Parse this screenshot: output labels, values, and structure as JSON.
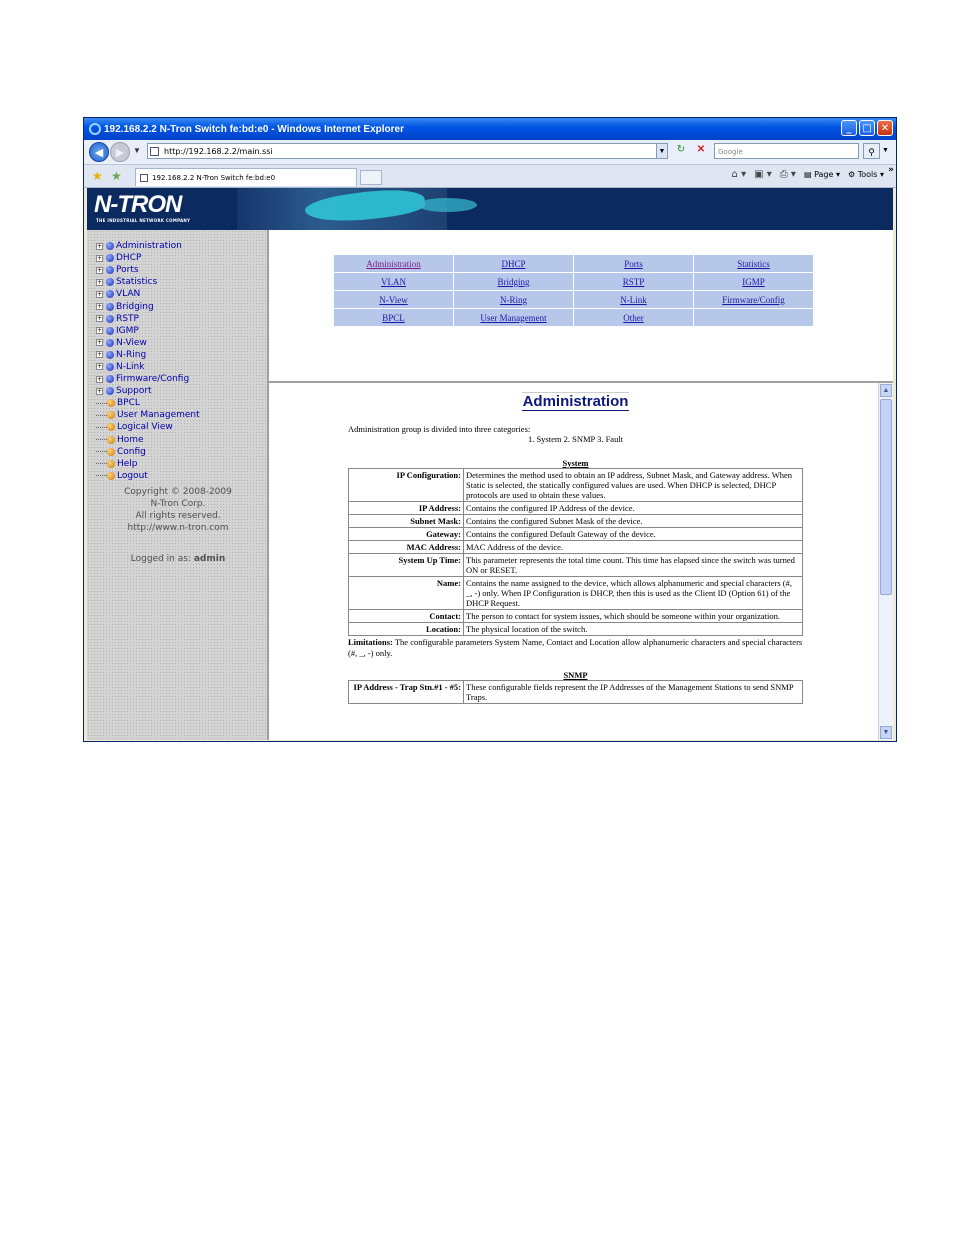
{
  "window": {
    "title": "192.168.2.2 N-Tron Switch fe:bd:e0 - Windows Internet Explorer",
    "address": "http://192.168.2.2/main.ssi",
    "search_placeholder": "Google",
    "tab_title": "192.168.2.2 N-Tron Switch fe:bd:e0",
    "cmd_page": "Page",
    "cmd_tools": "Tools"
  },
  "brand": {
    "logo": "N-TRON",
    "tagline": "THE INDUSTRIAL NETWORK COMPANY"
  },
  "sidebar": {
    "items": [
      {
        "label": "Administration",
        "expandable": true,
        "color": "blue"
      },
      {
        "label": "DHCP",
        "expandable": true,
        "color": "blue"
      },
      {
        "label": "Ports",
        "expandable": true,
        "color": "blue"
      },
      {
        "label": "Statistics",
        "expandable": true,
        "color": "blue"
      },
      {
        "label": "VLAN",
        "expandable": true,
        "color": "blue"
      },
      {
        "label": "Bridging",
        "expandable": true,
        "color": "blue"
      },
      {
        "label": "RSTP",
        "expandable": true,
        "color": "blue"
      },
      {
        "label": "IGMP",
        "expandable": true,
        "color": "blue"
      },
      {
        "label": "N-View",
        "expandable": true,
        "color": "blue"
      },
      {
        "label": "N-Ring",
        "expandable": true,
        "color": "blue"
      },
      {
        "label": "N-Link",
        "expandable": true,
        "color": "blue"
      },
      {
        "label": "Firmware/Config",
        "expandable": true,
        "color": "blue"
      },
      {
        "label": "Support",
        "expandable": true,
        "color": "blue"
      },
      {
        "label": "BPCL",
        "expandable": false,
        "color": "orange"
      },
      {
        "label": "User Management",
        "expandable": false,
        "color": "orange"
      },
      {
        "label": "Logical View",
        "expandable": false,
        "color": "orange"
      },
      {
        "label": "Home",
        "expandable": false,
        "color": "orange"
      },
      {
        "label": "Config",
        "expandable": false,
        "color": "orange"
      },
      {
        "label": "Help",
        "expandable": false,
        "color": "orange"
      },
      {
        "label": "Logout",
        "expandable": false,
        "color": "orange"
      }
    ],
    "copyright": [
      "Copyright © 2008-2009",
      "N-Tron Corp.",
      "All rights reserved.",
      "http://www.n-tron.com"
    ],
    "logged_in_label": "Logged in as:",
    "logged_in_user": "admin"
  },
  "nav_table": {
    "rows": [
      [
        "Administration",
        "DHCP",
        "Ports",
        "Statistics"
      ],
      [
        "VLAN",
        "Bridging",
        "RSTP",
        "IGMP"
      ],
      [
        "N-View",
        "N-Ring",
        "N-Link",
        "Firmware/Config"
      ],
      [
        "BPCL",
        "User Management",
        "Other",
        ""
      ]
    ]
  },
  "main": {
    "heading": "Administration",
    "intro": "Administration group is divided into three categories:",
    "categories": "1. System   2. SNMP   3. Fault",
    "system_title": "System",
    "system_rows": [
      {
        "label": "IP Configuration:",
        "desc": "Determines the method used to obtain an IP address, Subnet Mask, and Gateway address. When Static is selected, the statically configured values are used. When DHCP is selected, DHCP protocols are used to obtain these values."
      },
      {
        "label": "IP Address:",
        "desc": "Contains the configured IP Address of the device."
      },
      {
        "label": "Subnet Mask:",
        "desc": "Contains the configured Subnet Mask of the device."
      },
      {
        "label": "Gateway:",
        "desc": "Contains the configured Default Gateway of the device."
      },
      {
        "label": "MAC Address:",
        "desc": "MAC Address of the device."
      },
      {
        "label": "System Up Time:",
        "desc": "This parameter represents the total time count. This time has elapsed since the switch was turned ON or RESET."
      },
      {
        "label": "Name:",
        "desc": "Contains the name assigned to the device, which allows alphanumeric and special characters (#, _, -) only. When IP Configuration is DHCP, then this is used as the Client ID (Option 61) of the DHCP Request."
      },
      {
        "label": "Contact:",
        "desc": "The person to contact for system issues, which should be someone within your organization."
      },
      {
        "label": "Location:",
        "desc": "The physical location of the switch."
      }
    ],
    "limitations_label": "Limitations:",
    "limitations_text": "The configurable parameters System Name, Contact and Location allow alphanumeric characters and special characters (#, _, -) only.",
    "snmp_title": "SNMP",
    "snmp_rows": [
      {
        "label": "IP Address - Trap Stn.#1 - #5:",
        "desc": "These configurable fields represent the IP Addresses of the Management Stations to send SNMP Traps."
      }
    ]
  }
}
